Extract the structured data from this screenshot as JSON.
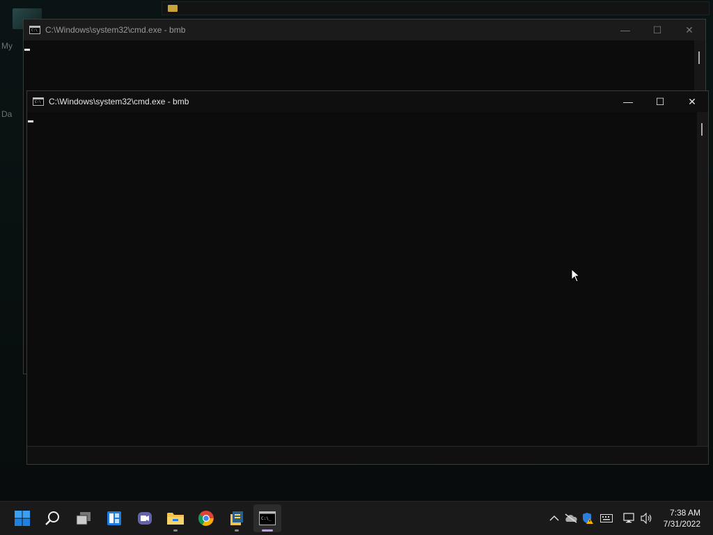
{
  "desktop": {
    "labels": [
      "My",
      "Da"
    ]
  },
  "windows": {
    "back": {
      "title": "C:\\Windows\\system32\\cmd.exe - bmb",
      "minimize": "—",
      "maximize": "☐",
      "close": "✕"
    },
    "front": {
      "title": "C:\\Windows\\system32\\cmd.exe - bmb",
      "minimize": "—",
      "maximize": "☐",
      "close": "✕"
    }
  },
  "taskbar": {
    "apps": [
      {
        "name": "start",
        "icon": "windows-logo-icon"
      },
      {
        "name": "search",
        "icon": "search-icon"
      },
      {
        "name": "task-view",
        "icon": "task-view-icon"
      },
      {
        "name": "widgets",
        "icon": "widgets-icon"
      },
      {
        "name": "chat",
        "icon": "teams-chat-icon"
      },
      {
        "name": "file-explorer",
        "icon": "folder-icon"
      },
      {
        "name": "chrome",
        "icon": "chrome-icon"
      },
      {
        "name": "python",
        "icon": "python-icon"
      },
      {
        "name": "terminal",
        "icon": "cmd-icon"
      }
    ],
    "tray": {
      "chevron": "^",
      "clock_time": "7:38 AM",
      "clock_date": "7/31/2022"
    }
  },
  "colors": {
    "accent": "#0078d4",
    "active_indicator": "#c79ce6",
    "folder": "#f2c14e"
  }
}
